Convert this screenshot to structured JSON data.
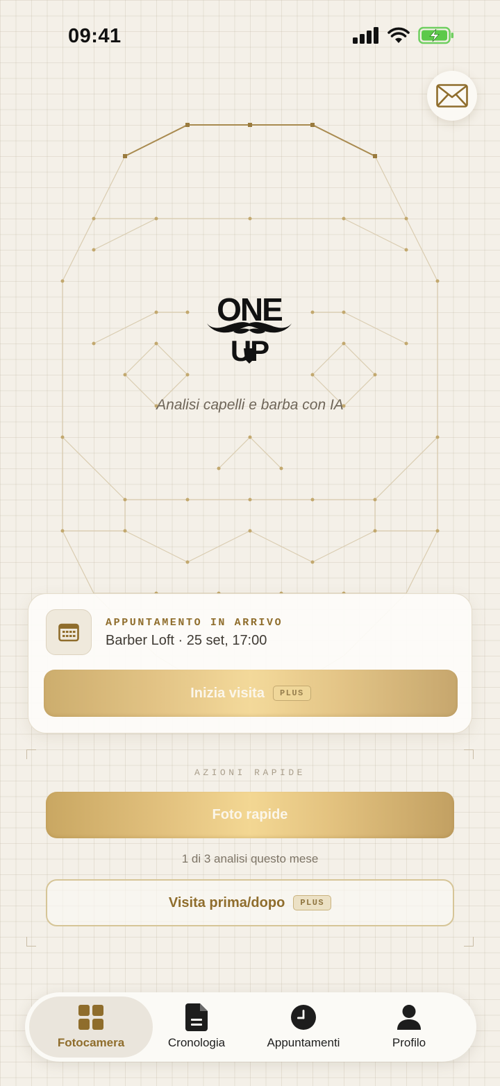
{
  "status_bar": {
    "time": "09:41",
    "icons": [
      "cellular-signal-icon",
      "wifi-icon",
      "battery-charging-icon"
    ]
  },
  "header": {
    "inbox_icon": "envelope-icon"
  },
  "branding": {
    "logo_line_1": "ONE",
    "logo_line_2": "UP",
    "tagline": "Analisi capelli e barba con IA"
  },
  "appointment_card": {
    "icon": "calendar-icon",
    "heading": "APPUNTAMENTO IN ARRIVO",
    "detail": "Barber Loft · 25 set, 17:00",
    "start_button_label": "Inizia visita",
    "start_button_badge": "PLUS"
  },
  "quick_actions": {
    "heading": "AZIONI RAPIDE",
    "quick_photos_label": "Foto rapide",
    "quota_text": "1 di 3 analisi questo mese",
    "before_after_label": "Visita prima/dopo",
    "before_after_badge": "PLUS"
  },
  "bottom_nav": {
    "items": [
      {
        "label": "Fotocamera",
        "icon": "grid-icon",
        "active": true
      },
      {
        "label": "Cronologia",
        "icon": "document-icon",
        "active": false
      },
      {
        "label": "Appuntamenti",
        "icon": "clock-icon",
        "active": false
      },
      {
        "label": "Profilo",
        "icon": "person-icon",
        "active": false
      }
    ]
  },
  "colors": {
    "background": "#f4f0e8",
    "accent_gold": "#8f6d2c",
    "button_gold": "#e3c27f",
    "text_dark": "#1d1d1d"
  }
}
